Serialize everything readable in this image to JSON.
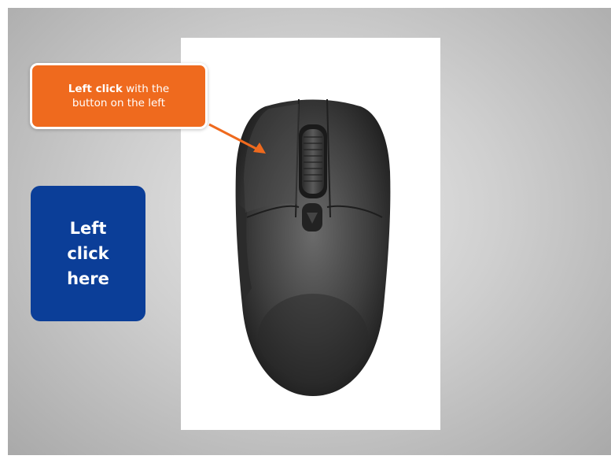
{
  "slide": {
    "callout": {
      "bold_text": "Left click",
      "rest_line1": " with the",
      "line2": "button on the left"
    },
    "left_click_button": {
      "line1": "Left",
      "line2": "click",
      "line3": "here"
    },
    "image": {
      "icon": "computer-mouse-photo"
    },
    "colors": {
      "callout": "#ef6a1e",
      "button": "#0b3e98",
      "arrow": "#ef6a1e"
    }
  }
}
